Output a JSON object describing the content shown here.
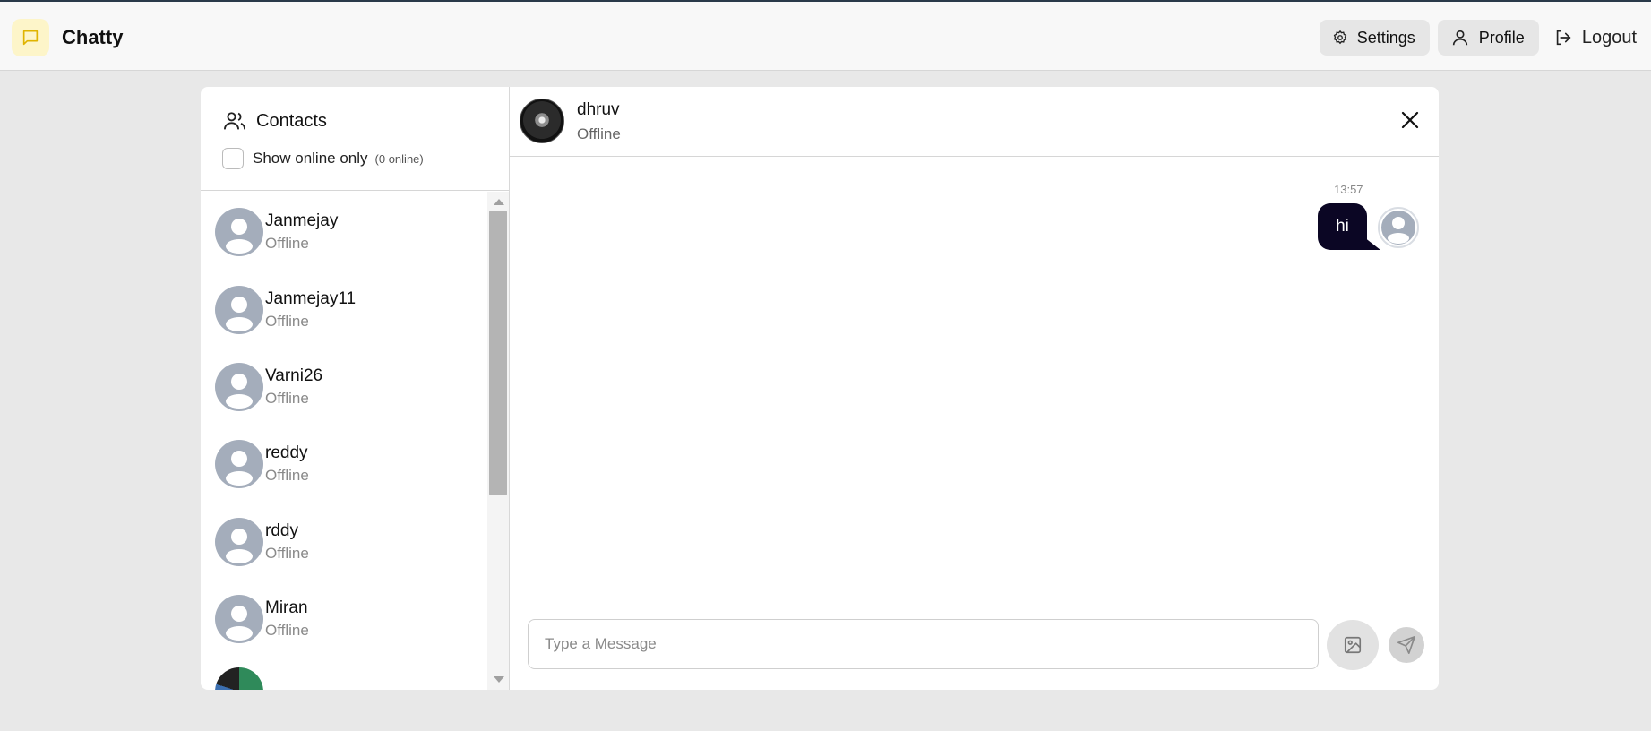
{
  "app": {
    "name": "Chatty",
    "logo_icon": "message-square-icon",
    "accent_color": "#fdf5c9"
  },
  "nav": {
    "settings_label": "Settings",
    "profile_label": "Profile",
    "logout_label": "Logout"
  },
  "sidebar": {
    "title": "Contacts",
    "online_filter_label": "Show online only",
    "online_count": "(0 online)",
    "contacts": [
      {
        "name": "Janmejay",
        "status": "Offline"
      },
      {
        "name": "Janmejay11",
        "status": "Offline"
      },
      {
        "name": "Varni26",
        "status": "Offline"
      },
      {
        "name": "reddy",
        "status": "Offline"
      },
      {
        "name": "rddy",
        "status": "Offline"
      },
      {
        "name": "Miran",
        "status": "Offline"
      }
    ]
  },
  "chat": {
    "contact_name": "dhruv",
    "contact_status": "Offline",
    "messages": [
      {
        "time": "13:57",
        "text": "hi",
        "sender": "me"
      }
    ],
    "input_placeholder": "Type a Message",
    "bubble_color": "#0b0624"
  }
}
